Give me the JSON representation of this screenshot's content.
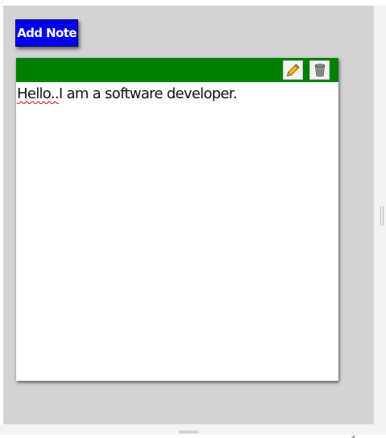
{
  "toolbar": {
    "add_note_label": "Add Note"
  },
  "note": {
    "header_color": "#008000",
    "text_misspelled": "Hello..",
    "text_rest": "I am a software developer.",
    "edit_icon": "pencil-icon",
    "delete_icon": "trash-icon"
  },
  "colors": {
    "background": "#d3d3d3",
    "button": "#0000ee",
    "note_header": "#008000",
    "note_body": "#ffffff"
  }
}
